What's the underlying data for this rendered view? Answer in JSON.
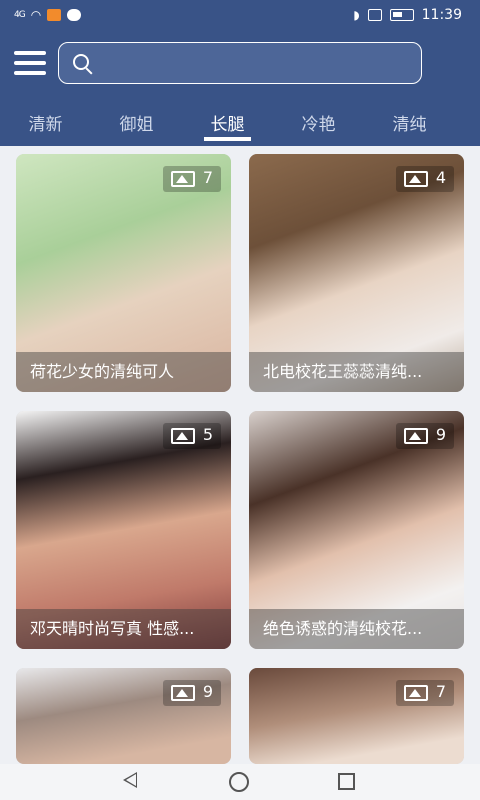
{
  "status": {
    "network": "4G",
    "time": "11:39"
  },
  "search": {
    "placeholder": ""
  },
  "tabs": [
    {
      "label": "清新"
    },
    {
      "label": "御姐"
    },
    {
      "label": "长腿"
    },
    {
      "label": "冷艳"
    },
    {
      "label": "清纯"
    }
  ],
  "active_tab": "长腿",
  "albums": [
    {
      "title": "荷花少女的清纯可人",
      "count": "7"
    },
    {
      "title": "北电校花王蕊蕊清纯...",
      "count": "4"
    },
    {
      "title": "邓天晴时尚写真 性感...",
      "count": "5"
    },
    {
      "title": "绝色诱惑的清纯校花...",
      "count": "9"
    },
    {
      "title": "",
      "count": "9"
    },
    {
      "title": "",
      "count": "7"
    }
  ],
  "colors": {
    "primary": "#395387",
    "caption_bg": "rgba(60,60,60,0.45)"
  }
}
